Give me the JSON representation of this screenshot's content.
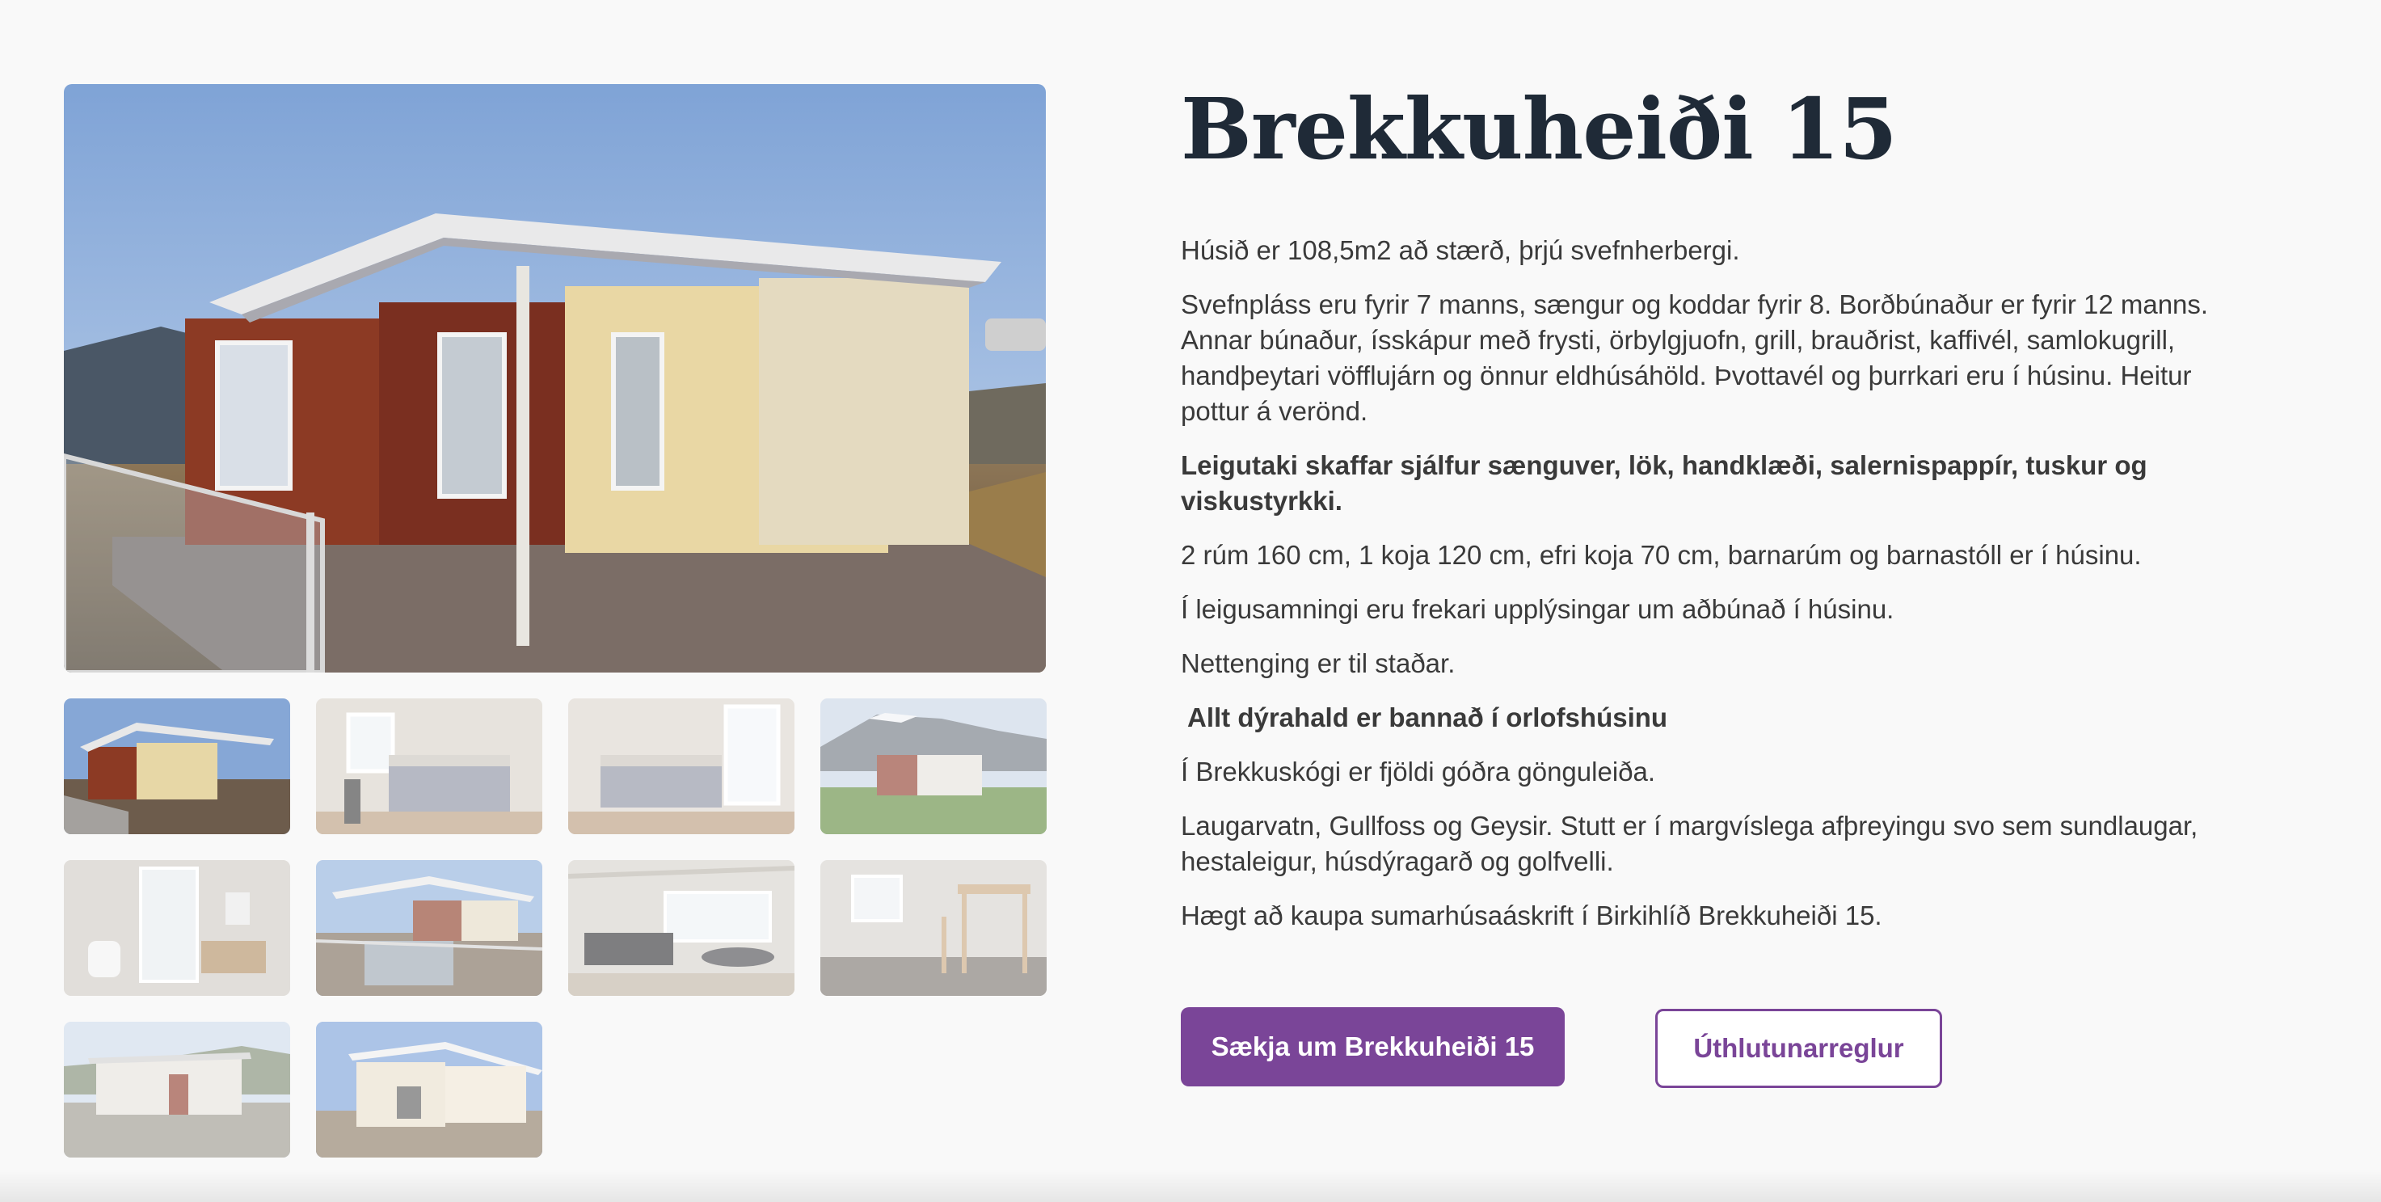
{
  "property": {
    "title": "Brekkuheiði 15",
    "paragraphs": [
      {
        "text": "Húsið er 108,5m2 að stærð, þrjú svefnherbergi.",
        "bold": false
      },
      {
        "text": "Svefnpláss eru fyrir 7 manns,  sængur og koddar fyrir 8.  Borðbúnaður er fyrir 12 manns. Annar búnaður, ísskápur með frysti, örbylgjuofn, grill, brauðrist, kaffivél, samlokugrill, handþeytari vöfflujárn og önnur eldhúsáhöld.  Þvottavél og þurrkari eru í húsinu. Heitur pottur á verönd.",
        "bold": false
      },
      {
        "text": "Leigutaki skaffar sjálfur sænguver, lök, handklæði, salernispappír,  tuskur og viskustyrkki.",
        "bold": true
      },
      {
        "text": "2 rúm 160 cm, 1 koja 120 cm, efri koja 70 cm, barnarúm og barnastóll er í húsinu.",
        "bold": false
      },
      {
        "text": "Í leigusamningi eru frekari upplýsingar um aðbúnað í húsinu.",
        "bold": false
      },
      {
        "text": "Nettenging er til staðar.",
        "bold": false
      },
      {
        "text": "Allt dýrahald er bannað í orlofshúsinu",
        "bold": true
      },
      {
        "text": "Í Brekkuskógi er fjöldi góðra gönguleiða.",
        "bold": false
      },
      {
        "text": "Laugarvatn, Gullfoss og Geysir. Stutt er í margvíslega afþreyingu svo sem sundlaugar, hestaleigur, húsdýragarð og golfvelli.",
        "bold": false
      },
      {
        "text": "Hægt að kaupa sumarhúsaáskrift í Birkihlíð Brekkuheiði 15.",
        "bold": false
      }
    ]
  },
  "actions": {
    "apply_label": "Sækja um Brekkuheiði 15",
    "rules_label": "Úthlutunarreglur"
  },
  "colors": {
    "accent": "#7a4598",
    "title": "#1f2a37",
    "text": "#3a3a3a",
    "background": "#f9f9f9"
  },
  "gallery": {
    "selected_index": 0,
    "thumbnails": [
      {
        "scene": "house-exterior"
      },
      {
        "scene": "bedroom-window"
      },
      {
        "scene": "bedroom-double-bed"
      },
      {
        "scene": "house-mountain-view"
      },
      {
        "scene": "bathroom"
      },
      {
        "scene": "deck-hot-tub"
      },
      {
        "scene": "living-room"
      },
      {
        "scene": "bunk-bed-room"
      },
      {
        "scene": "house-back-hillside"
      },
      {
        "scene": "house-side"
      }
    ]
  }
}
